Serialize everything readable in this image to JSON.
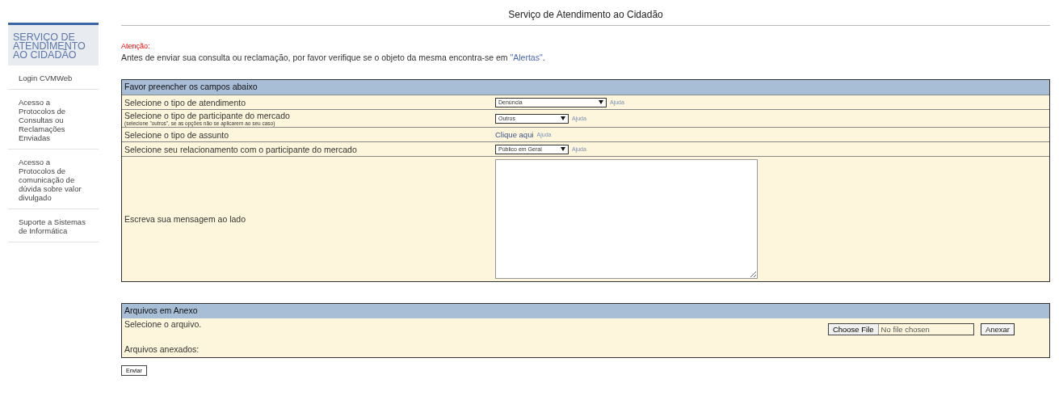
{
  "sidebar": {
    "title": "SERVIÇO DE ATENDIMENTO AO CIDADÃO",
    "items": [
      {
        "label": "Login CVMWeb"
      },
      {
        "label": "Acesso a Protocolos de Consultas ou Reclamações Enviadas"
      },
      {
        "label": "Acesso a Protocolos de comunicação de dúvida sobre valor divulgado"
      },
      {
        "label": "Suporte a Sistemas de Informática"
      }
    ]
  },
  "page_title": "Serviço de Atendimento ao Cidadão",
  "notice": {
    "label": "Atenção:",
    "text_before": "Antes de enviar sua consulta ou reclamação, por favor verifique se o objeto da mesma encontra-se em ",
    "link": "\"Alertas\"",
    "text_after": "."
  },
  "form": {
    "header": "Favor preencher os campos abaixo",
    "rows": [
      {
        "kind": "wide_select",
        "label": "Selecione o tipo de atendimento",
        "value": "Denúncia",
        "help": "Ajuda"
      },
      {
        "kind": "select",
        "label": "Selecione o tipo de participante do mercado",
        "hint": "(selecione \"outros\", se as opções não se aplicarem ao seu caso)",
        "value": "Outros",
        "help": "Ajuda"
      },
      {
        "kind": "link",
        "label": "Selecione o tipo de assunto",
        "value": "Clique aqui",
        "help": "Ajuda"
      },
      {
        "kind": "select",
        "label": "Selecione seu relacionamento com o participante do mercado",
        "value": "Público em Geral",
        "help": "Ajuda"
      },
      {
        "kind": "textarea",
        "label": "Escreva sua mensagem ao lado"
      }
    ]
  },
  "attachments": {
    "header": "Arquivos em Anexo",
    "select_label": "Selecione o arquivo.",
    "file_button": "Choose File",
    "file_status": "No file chosen",
    "attach_button": "Anexar",
    "attached_label": "Arquivos anexados:"
  },
  "submit": "Enviar"
}
